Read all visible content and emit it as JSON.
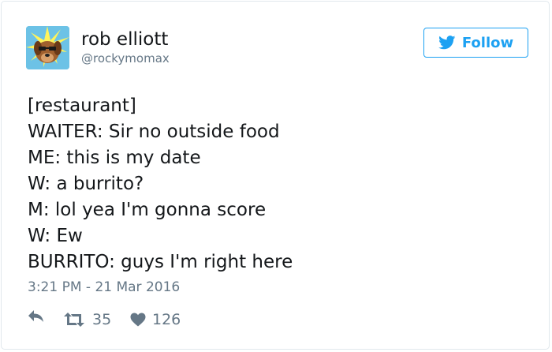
{
  "user": {
    "name": "rob elliott",
    "handle": "@rockymomax"
  },
  "follow_button": {
    "label": "Follow",
    "icon": "twitter-bird-icon",
    "color": "#1da1f2"
  },
  "tweet": {
    "lines": [
      "[restaurant]",
      "WAITER: Sir no outside food",
      "ME: this is my date",
      "W: a burrito?",
      "M: lol yea I'm gonna score",
      "W: Ew",
      "BURRITO: guys I'm right here"
    ],
    "timestamp": "3:21 PM - 21 Mar 2016"
  },
  "actions": {
    "reply_icon": "reply-icon",
    "retweet_icon": "retweet-icon",
    "retweet_count": "35",
    "like_icon": "heart-icon",
    "like_count": "126"
  }
}
